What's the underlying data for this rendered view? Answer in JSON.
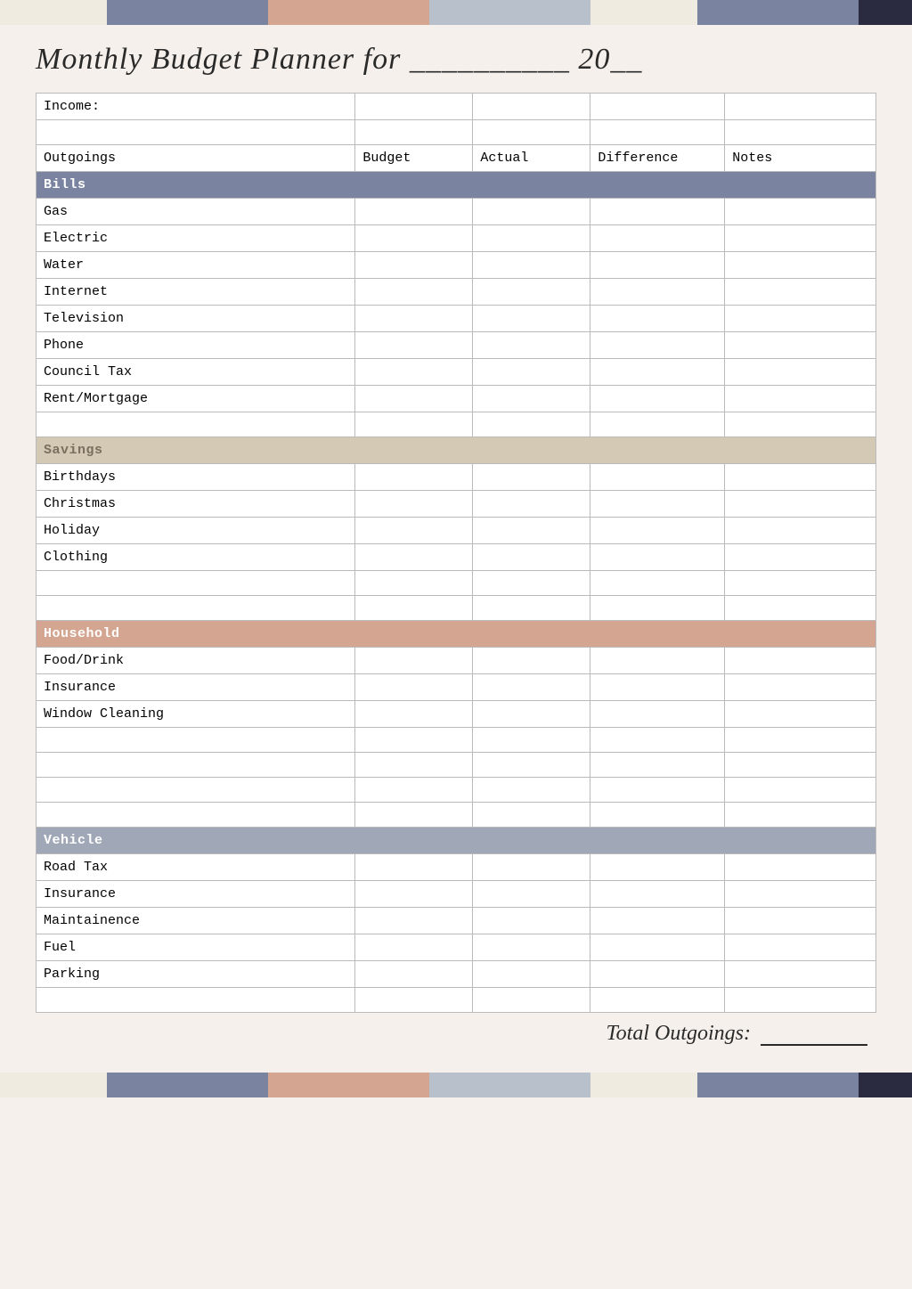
{
  "page": {
    "title": "Monthly Budget Planner for __________ 20__",
    "total_label": "Total Outgoings:",
    "total_line": "_____"
  },
  "color_bars": {
    "top": [
      {
        "color": "#f0ebe0",
        "flex": 2
      },
      {
        "color": "#7a84a0",
        "flex": 3
      },
      {
        "color": "#d4a590",
        "flex": 3
      },
      {
        "color": "#b8c0cc",
        "flex": 3
      },
      {
        "color": "#f0ebe0",
        "flex": 2
      },
      {
        "color": "#7a84a0",
        "flex": 3
      },
      {
        "color": "#2a2a40",
        "flex": 1
      }
    ],
    "bottom": [
      {
        "color": "#f0ebe0",
        "flex": 2
      },
      {
        "color": "#7a84a0",
        "flex": 3
      },
      {
        "color": "#d4a590",
        "flex": 3
      },
      {
        "color": "#b8c0cc",
        "flex": 3
      },
      {
        "color": "#f0ebe0",
        "flex": 2
      },
      {
        "color": "#7a84a0",
        "flex": 3
      },
      {
        "color": "#2a2a40",
        "flex": 1
      }
    ]
  },
  "table": {
    "income_label": "Income:",
    "columns": {
      "outgoings": "Outgoings",
      "budget": "Budget",
      "actual": "Actual",
      "difference": "Difference",
      "notes": "Notes"
    },
    "sections": {
      "bills": {
        "label": "Bills",
        "items": [
          "Gas",
          "Electric",
          "Water",
          "Internet",
          "Television",
          "Phone",
          "Council Tax",
          "Rent/Mortgage"
        ]
      },
      "savings": {
        "label": "Savings",
        "items": [
          "Birthdays",
          "Christmas",
          "Holiday",
          "Clothing"
        ]
      },
      "household": {
        "label": "Household",
        "items": [
          "Food/Drink",
          "Insurance",
          "Window Cleaning"
        ]
      },
      "vehicle": {
        "label": "Vehicle",
        "items": [
          "Road Tax",
          "Insurance",
          "Maintainence",
          "Fuel",
          "Parking"
        ]
      }
    }
  }
}
